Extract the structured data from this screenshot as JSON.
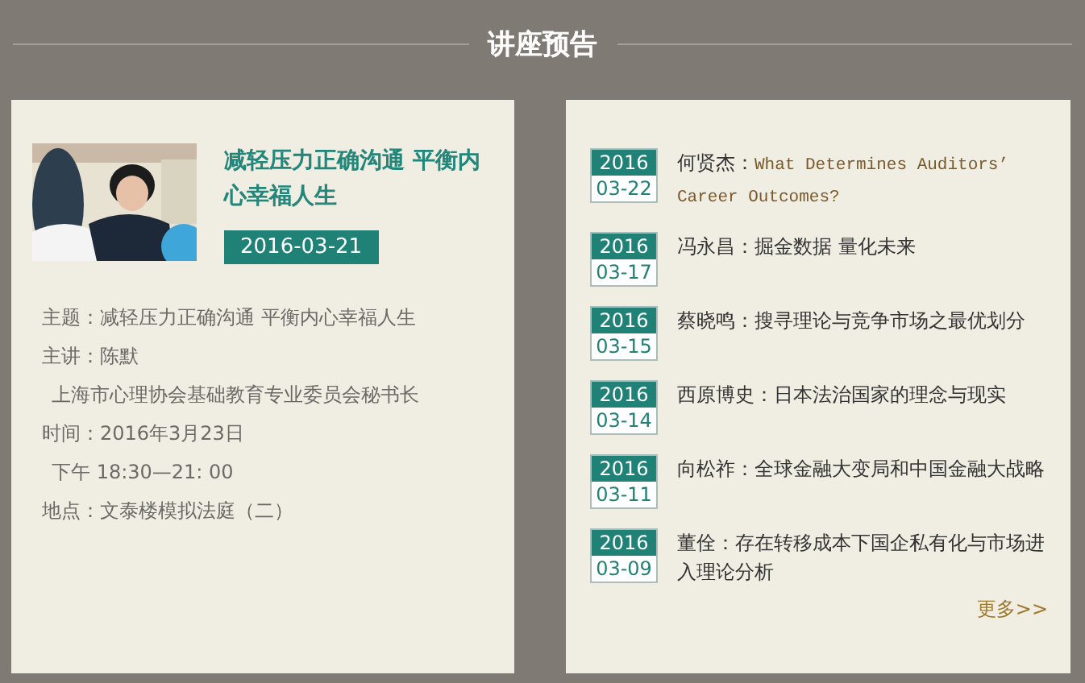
{
  "section_title": "讲座预告",
  "featured": {
    "kind": "picture",
    "title": "减轻压力正确沟通  平衡内心幸福人生",
    "date": "2016-03-21",
    "details": [
      {
        "kind": "field",
        "label": "主题：",
        "value": "减轻压力正确沟通 平衡内心幸福人生"
      },
      {
        "kind": "field",
        "label": "主讲：",
        "value": "陈默"
      },
      {
        "kind": "indent",
        "value": "上海市心理协会基础教育专业委员会秘书长"
      },
      {
        "kind": "field",
        "label": "时间：",
        "value": "2016年3月23日"
      },
      {
        "kind": "indent",
        "value": "下午 18:30—21: 00"
      },
      {
        "kind": "field",
        "label": "地点：",
        "value": "文泰楼模拟法庭（二）"
      }
    ]
  },
  "lectures": [
    {
      "year": "2016",
      "date": "03-22",
      "speaker": "何贤杰：",
      "title": "What Determines Auditors’ Career Outcomes?",
      "kind": "latin"
    },
    {
      "year": "2016",
      "date": "03-17",
      "speaker": "冯永昌：",
      "title": "掘金数据 量化未来",
      "kind": "cjk"
    },
    {
      "year": "2016",
      "date": "03-15",
      "speaker": "蔡晓鸣：",
      "title": "搜寻理论与竞争市场之最优划分",
      "kind": "cjk"
    },
    {
      "year": "2016",
      "date": "03-14",
      "speaker": "西原博史：",
      "title": "日本法治国家的理念与现实",
      "kind": "cjk"
    },
    {
      "year": "2016",
      "date": "03-11",
      "speaker": "向松祚：",
      "title": "全球金融大变局和中国金融大战略",
      "kind": "cjk"
    },
    {
      "year": "2016",
      "date": "03-09",
      "speaker": "董佺：",
      "title": "存在转移成本下国企私有化与市场进入理论分析",
      "kind": "cjk"
    }
  ],
  "more_link": "更多>>"
}
